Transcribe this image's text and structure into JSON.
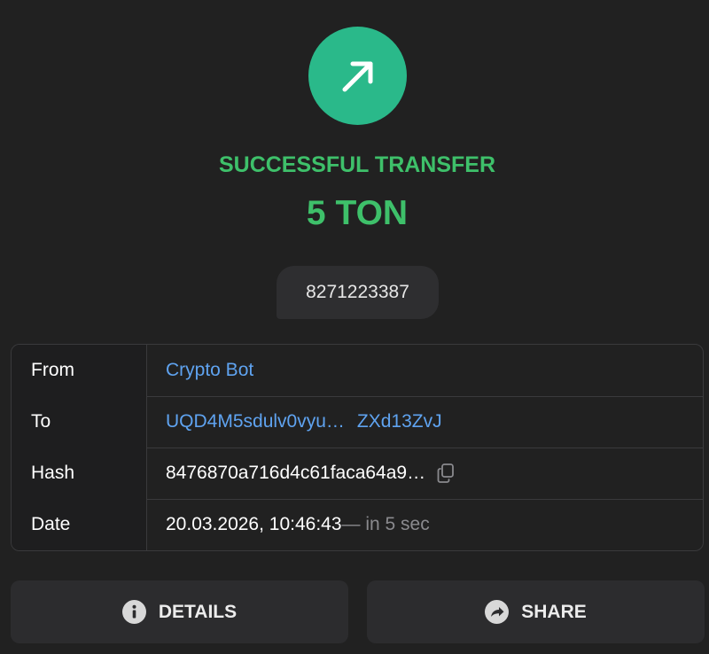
{
  "status": {
    "icon": "arrow-up-right-icon",
    "title": "SUCCESSFUL TRANSFER",
    "amount": "5 TON",
    "color": "#3ec06a",
    "circle_color": "#2ab98a"
  },
  "comment": "8271223387",
  "details": {
    "from_label": "From",
    "from_value": "Crypto Bot",
    "to_label": "To",
    "to_value_start": "UQD4M5sdulv0vyu…",
    "to_value_end": "ZXd13ZvJ",
    "hash_label": "Hash",
    "hash_value": "8476870a716d4c61faca64a9…",
    "date_label": "Date",
    "date_value": "20.03.2026, 10:46:43",
    "date_relative": " — in 5 sec"
  },
  "buttons": {
    "details_label": "DETAILS",
    "details_icon": "info-icon",
    "share_label": "SHARE",
    "share_icon": "share-icon"
  },
  "colors": {
    "background": "#212121",
    "link": "#5fa3f0",
    "button_bg": "#2c2c2e"
  }
}
